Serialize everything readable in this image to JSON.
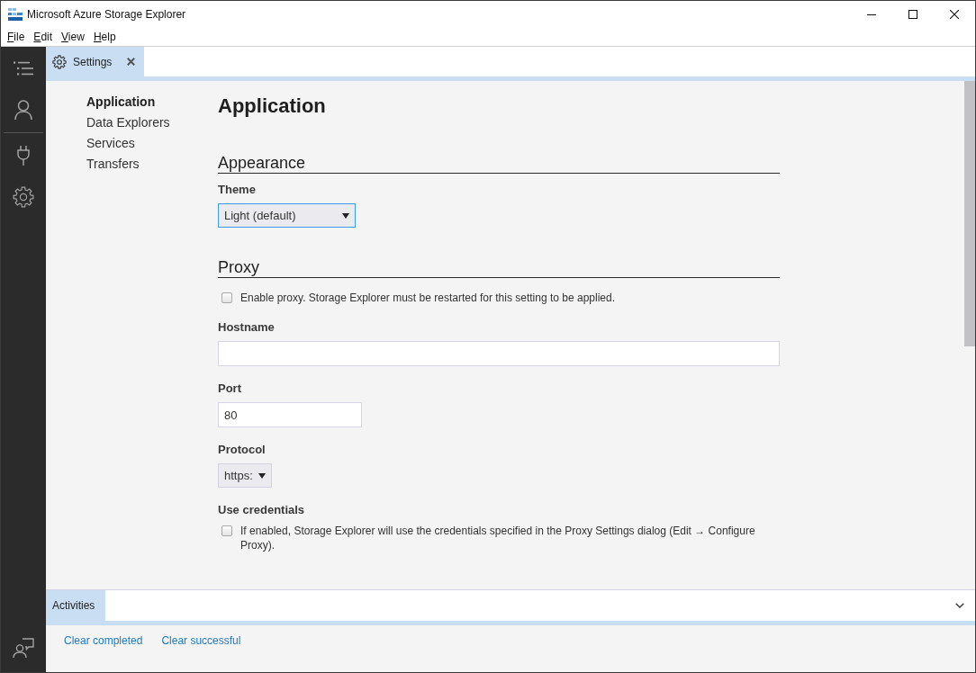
{
  "window": {
    "title": "Microsoft Azure Storage Explorer"
  },
  "menu_bar": [
    "File",
    "Edit",
    "View",
    "Help"
  ],
  "tabs": [
    {
      "label": "Settings",
      "selected": true
    }
  ],
  "settings_nav": [
    {
      "label": "Application",
      "selected": true
    },
    {
      "label": "Data Explorers",
      "selected": false
    },
    {
      "label": "Services",
      "selected": false
    },
    {
      "label": "Transfers",
      "selected": false
    }
  ],
  "page": {
    "title": "Application",
    "sections": [
      {
        "heading": "Appearance",
        "fields": [
          {
            "kind": "select",
            "label": "Theme",
            "value": "Light (default)",
            "focused": true
          }
        ]
      },
      {
        "heading": "Proxy",
        "fields": [
          {
            "kind": "checkbox",
            "text": "Enable proxy. Storage Explorer must be restarted for this setting to be applied.",
            "checked": false
          },
          {
            "kind": "text",
            "label": "Hostname"
          },
          {
            "kind": "number",
            "label": "Port",
            "value": "80"
          },
          {
            "kind": "select",
            "label": "Protocol",
            "value": "https:",
            "focused": false
          },
          {
            "kind": "checkbox",
            "label": "Use credentials",
            "text": "If enabled, Storage Explorer will use the credentials specified in the Proxy Settings dialog (Edit → Configure Proxy).",
            "checked": false
          }
        ]
      }
    ]
  },
  "activities": {
    "tab": {
      "label": "Activities",
      "selected": true
    },
    "actions": [
      "Clear completed",
      "Clear successful"
    ]
  }
}
